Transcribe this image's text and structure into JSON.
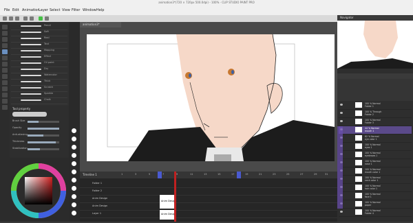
{
  "app": {
    "window_title": "animation3*(720 × 720px 500.0dpi) - 100% · CLIP STUDIO PAINT PRO"
  },
  "menu": [
    "File",
    "Edit",
    "Animation",
    "Layer",
    "Select",
    "View",
    "Filter",
    "Window",
    "Help"
  ],
  "canvas_tab": "animation3*",
  "navigator_tab": "Navigator",
  "brush_panel": {
    "subtools": [
      "Pencil",
      "Soft",
      "Real",
      "Text",
      "Mapping",
      "Effect",
      "Oil paint",
      "Dry",
      "Watercolor",
      "Thick",
      "Scratch",
      "Sparkle",
      "Chalk"
    ]
  },
  "tool_property": {
    "title": "Tool property",
    "rows": [
      {
        "label": "Brush Size",
        "value": 0.35
      },
      {
        "label": "Opacity",
        "value": 1.0
      },
      {
        "label": "Anti-aliasing",
        "value": 0.5
      },
      {
        "label": "Thickness",
        "value": 0.9
      },
      {
        "label": "Stabilization",
        "value": 0.4
      }
    ]
  },
  "timeline": {
    "title": "Timeline 1",
    "frame_numbers": [
      "1",
      "3",
      "5",
      "7",
      "9",
      "11",
      "13",
      "15",
      "17",
      "19",
      "21",
      "23",
      "25",
      "27",
      "29",
      "31",
      "33",
      "35"
    ],
    "rows": [
      {
        "name": "Folder 1"
      },
      {
        "name": "Folder 2"
      },
      {
        "name": "Anim Design"
      },
      {
        "name": "Anim Design"
      },
      {
        "name": "Layer 1"
      }
    ],
    "cel_labels": [
      "Anim Design",
      "Anim Design"
    ]
  },
  "layers": {
    "rows": [
      {
        "name": "100 % Normal\nFolder 1",
        "selected": false
      },
      {
        "name": "100 % Through\nFolder 2",
        "selected": false
      },
      {
        "name": "100 % Normal\nFolder 3",
        "selected": false
      },
      {
        "name": "44 % Normal\nmouth 1",
        "selected": true
      },
      {
        "name": "82 % Normal\neye color 1",
        "selected": false
      },
      {
        "name": "100 % Normal\neyes 1",
        "selected": false
      },
      {
        "name": "100 % Normal\neyebrows 1",
        "selected": false
      },
      {
        "name": "100 % Normal\nnose 1",
        "selected": false
      },
      {
        "name": "100 % Normal\nmouth color 1",
        "selected": false
      },
      {
        "name": "100 % Normal\nneck color 1",
        "selected": false
      },
      {
        "name": "100 % Normal\nhair color 1",
        "selected": false
      },
      {
        "name": "100 % Normal\nface 1",
        "selected": false
      },
      {
        "name": "100 % Normal\npaper",
        "selected": false
      },
      {
        "name": "100 % Normal\nFolder 4",
        "selected": false
      }
    ]
  },
  "colors": {
    "skin": "#f6d8c8",
    "accent_purple": "#6b4fb0",
    "playhead": "#c02020"
  }
}
